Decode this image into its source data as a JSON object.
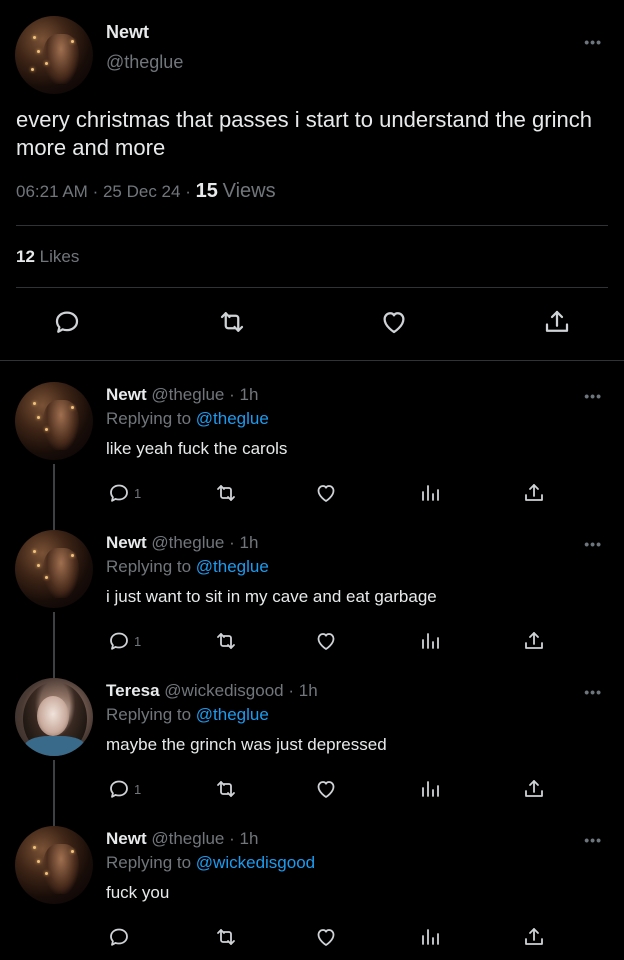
{
  "main_tweet": {
    "name": "Newt",
    "handle": "@theglue",
    "text": "every christmas that passes i start to understand the grinch more and more",
    "time": "06:21 AM",
    "date": "25 Dec 24",
    "separator": "·",
    "views_count": "15",
    "views_label": "Views",
    "likes_count": "12",
    "likes_label": "Likes",
    "more": "•••"
  },
  "replies": [
    {
      "name": "Newt",
      "handle": "@theglue",
      "time": "· 1h",
      "replying_prefix": "Replying to",
      "replying_to": "@theglue",
      "text": "like yeah fuck the carols",
      "reply_count": "1",
      "more": "•••"
    },
    {
      "name": "Newt",
      "handle": "@theglue",
      "time": "· 1h",
      "replying_prefix": "Replying to",
      "replying_to": "@theglue",
      "text": "i just want to sit in my cave and eat garbage",
      "reply_count": "1",
      "more": "•••"
    },
    {
      "name": "Teresa",
      "handle": "@wickedisgood",
      "time": "· 1h",
      "replying_prefix": "Replying to",
      "replying_to": "@theglue",
      "text": "maybe the grinch was just depressed",
      "reply_count": "1",
      "more": "•••"
    },
    {
      "name": "Newt",
      "handle": "@theglue",
      "time": "· 1h",
      "replying_prefix": "Replying to",
      "replying_to": "@wickedisgood",
      "text": "fuck you",
      "reply_count": "",
      "more": "•••"
    }
  ],
  "icons": [
    "reply-icon",
    "retweet-icon",
    "like-icon",
    "views-icon",
    "share-icon",
    "more-icon"
  ],
  "colors": {
    "background": "#000000",
    "text": "#e7e9ea",
    "muted": "#71767b",
    "link": "#1d9bf0",
    "divider": "#2f3336"
  }
}
